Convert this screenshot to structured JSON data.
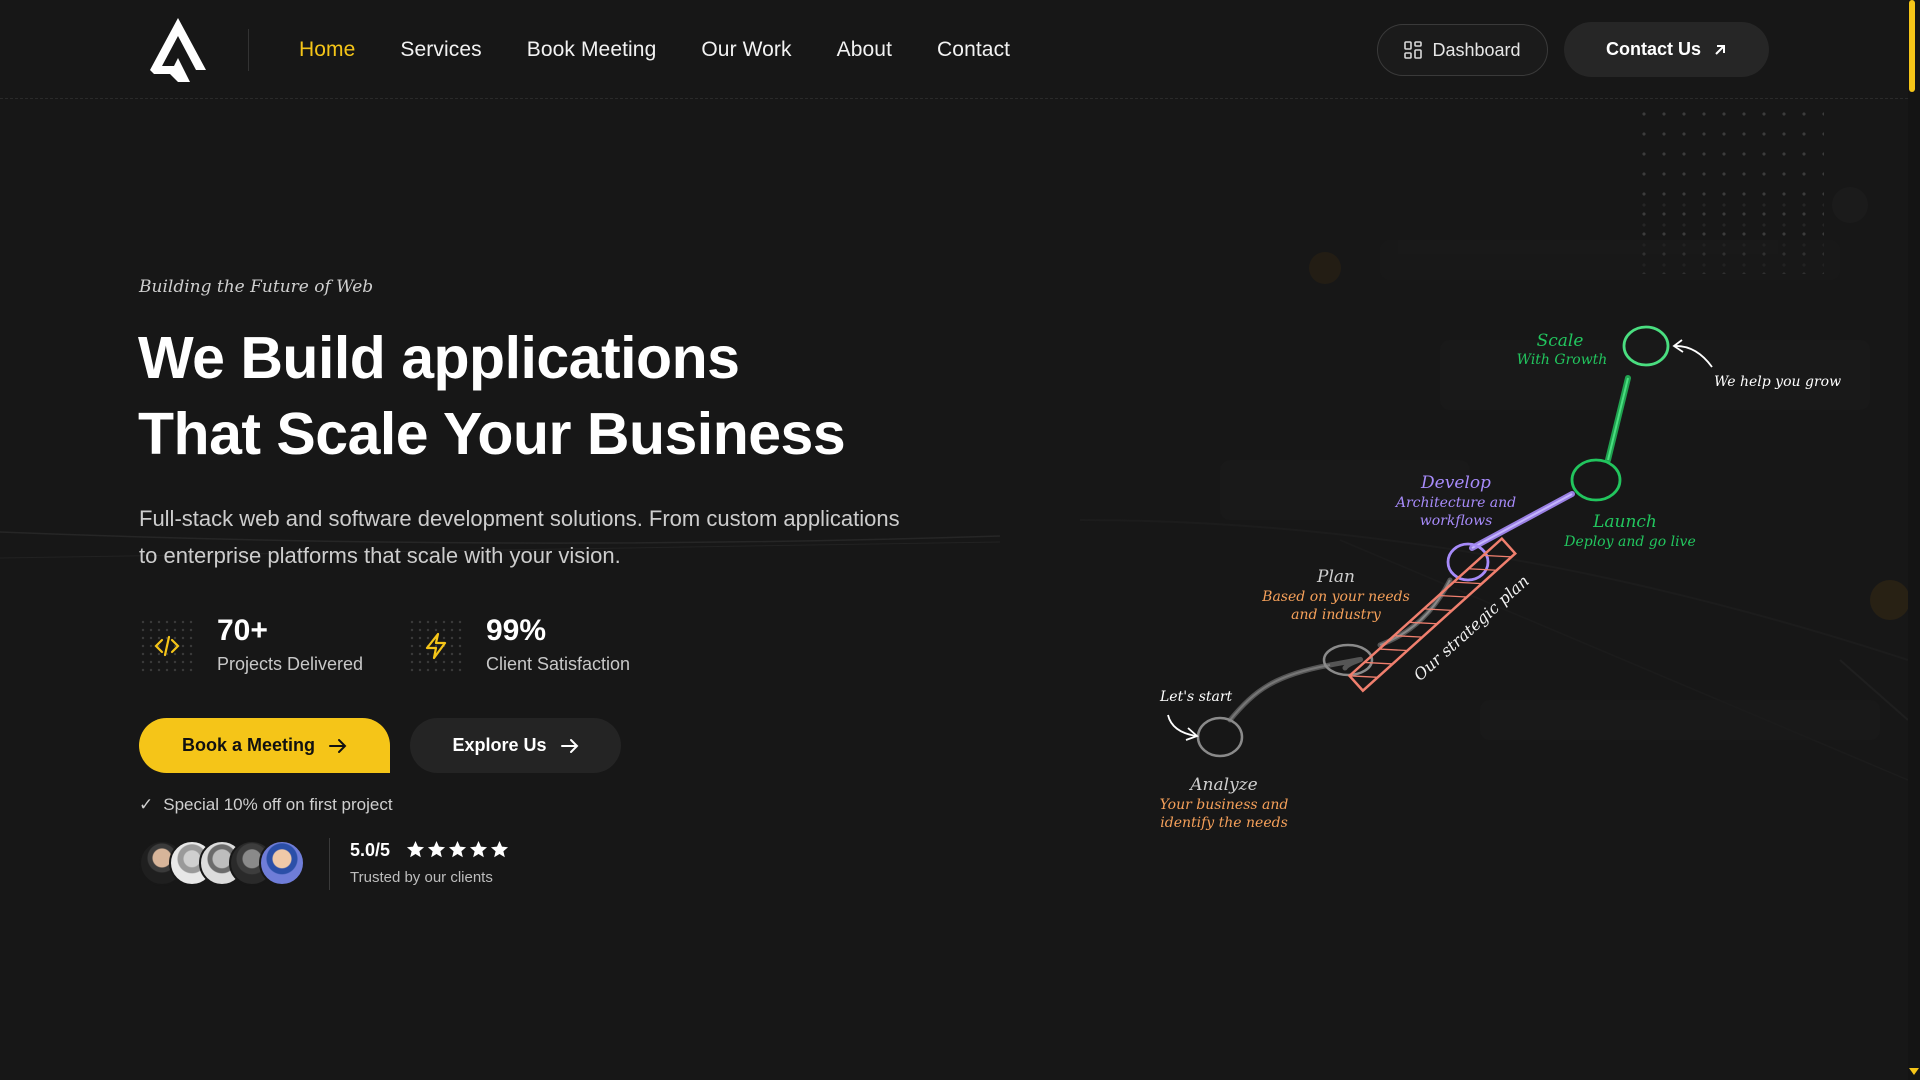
{
  "header": {
    "logo_name": "logo-mark",
    "nav": [
      {
        "label": "Home",
        "active": true
      },
      {
        "label": "Services",
        "active": false
      },
      {
        "label": "Book Meeting",
        "active": false
      },
      {
        "label": "Our Work",
        "active": false
      },
      {
        "label": "About",
        "active": false
      },
      {
        "label": "Contact",
        "active": false
      }
    ],
    "dashboard_label": "Dashboard",
    "dashboard_icon": "dashboard-grid-icon",
    "contact_label": "Contact Us",
    "contact_icon": "arrow-up-right-icon"
  },
  "hero": {
    "eyebrow": "Building the Future of Web",
    "headline_line1": "We Build applications",
    "headline_line2": "That Scale Your Business",
    "subtext_line1": "Full-stack web and software development solutions. From custom applications",
    "subtext_line2": "to enterprise platforms that scale with your vision.",
    "stats": [
      {
        "icon": "code-icon",
        "value": "70+",
        "label": "Projects Delivered"
      },
      {
        "icon": "lightning-icon",
        "value": "99%",
        "label": "Client Satisfaction"
      }
    ],
    "primary_cta": "Book a Meeting",
    "secondary_cta": "Explore Us",
    "offer_check": "✓",
    "offer": "Special 10% off on first project",
    "rating": "5.0/5",
    "star_count": 5,
    "trusted": "Trusted by our clients"
  },
  "illustration": {
    "lets_start": "Let's start",
    "analyze_title": "Analyze",
    "analyze_desc_1": "Your business and",
    "analyze_desc_2": "identify the needs",
    "plan_title": "Plan",
    "plan_desc_1": "Based on your needs",
    "plan_desc_2": "and industry",
    "develop_title": "Develop",
    "develop_desc_1": "Architecture and",
    "develop_desc_2": "workflows",
    "launch_title": "Launch",
    "launch_desc": "Deploy and go live",
    "scale_title": "Scale",
    "scale_desc": "With Growth",
    "grow_note": "We help you grow",
    "strategic": "Our strategic plan"
  },
  "colors": {
    "accent": "#f5c518",
    "background": "#171717",
    "develop": "#a78bfa",
    "growth": "#4ade80",
    "plan_orange": "#f5a05a",
    "strategic": "#f07f6e"
  }
}
